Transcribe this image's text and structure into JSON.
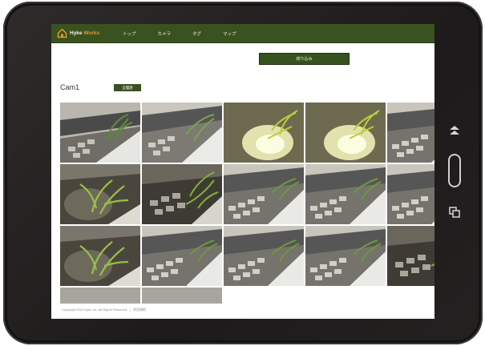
{
  "header": {
    "logo_text_part1": "Hyke",
    "logo_text_part2": " Works",
    "nav": [
      "トップ",
      "カメラ",
      "タグ",
      "マップ"
    ]
  },
  "toolbar": {
    "filter_label": "絞り込み"
  },
  "section": {
    "title": "Cam1",
    "show_all_label": "全履歴"
  },
  "gallery": {
    "tiles": [
      {
        "scene": "fence-moss"
      },
      {
        "scene": "fence-grass"
      },
      {
        "scene": "bright-plant"
      },
      {
        "scene": "bright-plant"
      },
      {
        "scene": "fence-path"
      },
      {
        "scene": "dark-plant"
      },
      {
        "scene": "dark-blocks"
      },
      {
        "scene": "fence-path"
      },
      {
        "scene": "fence-path"
      },
      {
        "scene": "fence-path"
      },
      {
        "scene": "dark-plant"
      },
      {
        "scene": "fence-path"
      },
      {
        "scene": "fence-path"
      },
      {
        "scene": "fence-path"
      },
      {
        "scene": "dark-blocks"
      },
      {
        "scene": "partial"
      },
      {
        "scene": "partial"
      }
    ]
  },
  "footer": {
    "copyright": "Copyright 2019 Hyke Inc. All Rights Reserved.",
    "privacy": "利用規約"
  },
  "colors": {
    "nav_bg": "#3a5120",
    "accent_orange": "#e39a2d",
    "button_bg": "#37521e"
  },
  "icons": {
    "side_top": "eject-icon",
    "side_middle": "home-button",
    "side_bottom": "multitask-icon"
  }
}
